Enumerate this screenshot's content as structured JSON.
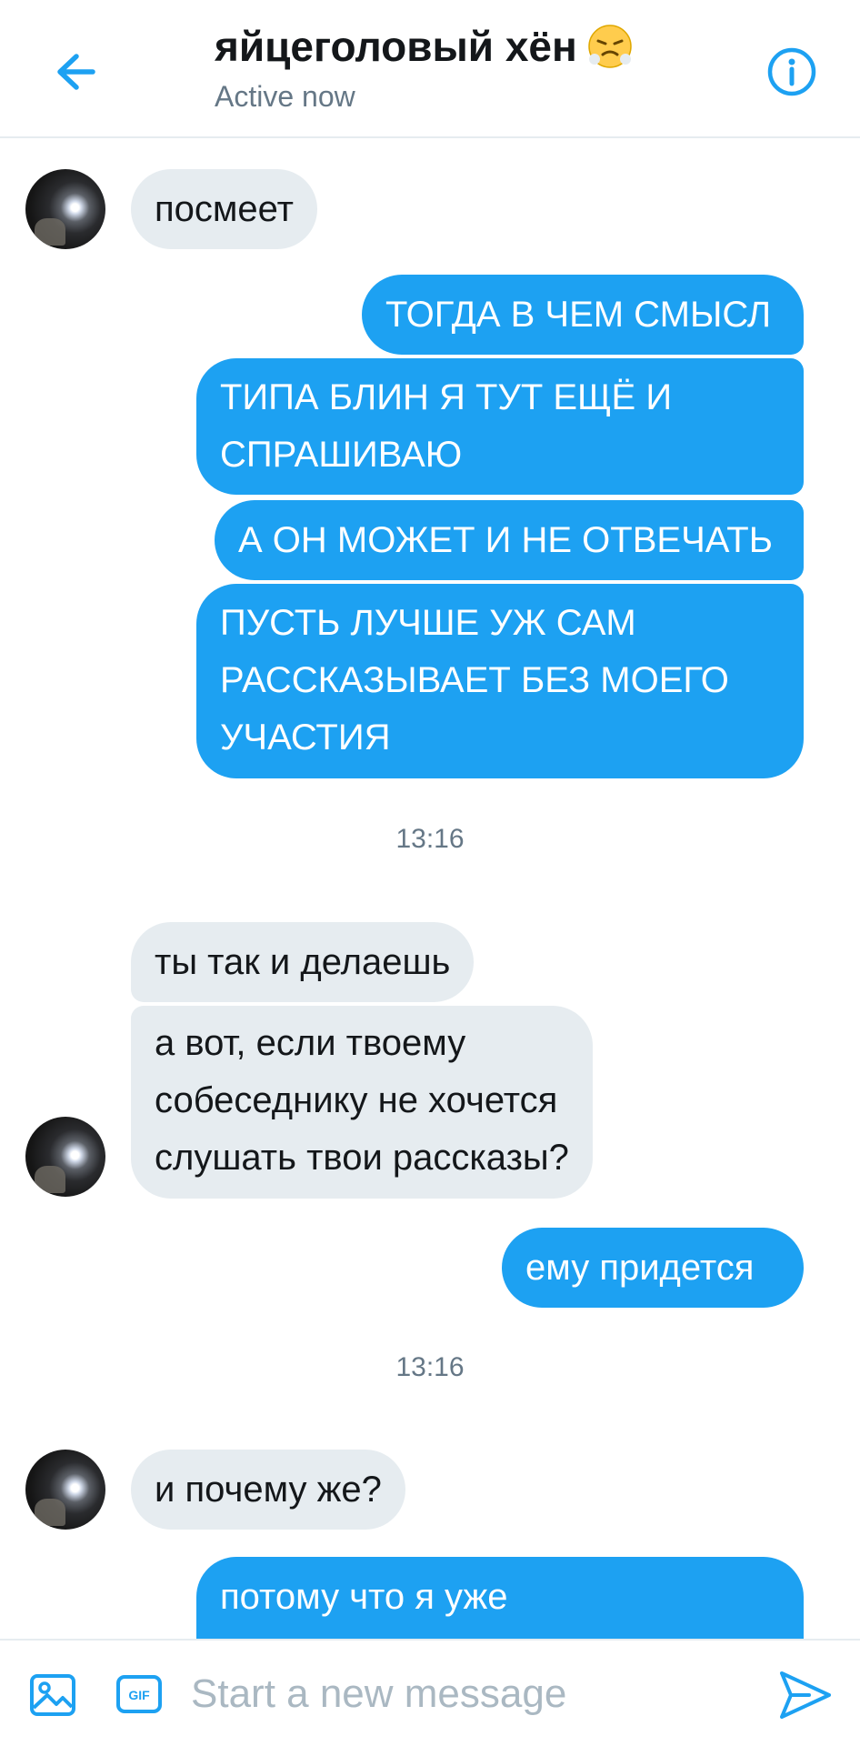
{
  "header": {
    "title": "яйцеголовый хён",
    "title_emoji": "face-with-steam-icon",
    "status": "Active now",
    "back_icon": "back-arrow-icon",
    "info_icon": "info-icon",
    "accent_color": "#1da1f2"
  },
  "messages": [
    {
      "direction": "in",
      "text": "посмеет"
    },
    {
      "direction": "out",
      "text": "ТОГДА В ЧЕМ СМЫСЛ"
    },
    {
      "direction": "out",
      "lines": [
        "ТИПА БЛИН Я ТУТ ЕЩЁ И",
        "СПРАШИВАЮ"
      ]
    },
    {
      "direction": "out",
      "text": "А ОН МОЖЕТ И НЕ ОТВЕЧАТЬ"
    },
    {
      "direction": "out",
      "lines": [
        "ПУСТЬ ЛУЧШЕ УЖ САМ",
        "РАССКАЗЫВАЕТ БЕЗ МОЕГО",
        "УЧАСТИЯ"
      ]
    },
    {
      "type": "timestamp",
      "text": "13:16"
    },
    {
      "direction": "in",
      "text": "ты так и делаешь"
    },
    {
      "direction": "in",
      "lines": [
        "а вот, если твоему",
        "собеседнику не хочется",
        "слушать твои рассказы?"
      ]
    },
    {
      "direction": "out",
      "text": "ему придется"
    },
    {
      "type": "timestamp",
      "text": "13:16"
    },
    {
      "direction": "in",
      "text": "и почему же?"
    },
    {
      "direction": "out",
      "text": "потому что я уже"
    }
  ],
  "composer": {
    "placeholder": "Start a new message",
    "value": "",
    "image_icon": "image-icon",
    "gif_icon": "gif-icon",
    "gif_label": "GIF",
    "send_icon": "send-icon"
  },
  "colors": {
    "incoming_bubble": "#e6ecf0",
    "outgoing_bubble": "#1da1f2",
    "text_dark": "#14171a",
    "text_muted": "#657786"
  }
}
